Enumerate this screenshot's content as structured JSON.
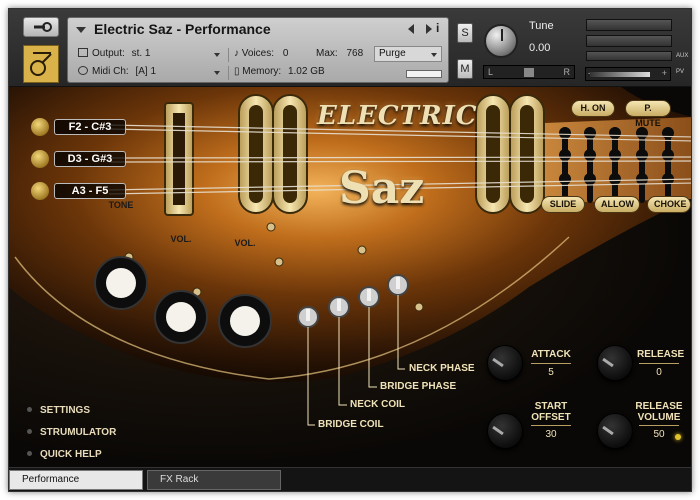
{
  "header": {
    "title": "Electric Saz - Performance",
    "output_label": "Output:",
    "output_value": "st. 1",
    "voices_label": "Voices:",
    "voices_value": "0",
    "max_label": "Max:",
    "max_value": "768",
    "purge_label": "Purge",
    "midi_label": "Midi Ch:",
    "midi_value": "[A]  1",
    "memory_label": "Memory:",
    "memory_value": "1.02 GB",
    "solo": "S",
    "mute": "M",
    "tune_label": "Tune",
    "tune_value": "0.00",
    "pan_left": "L",
    "pan_right": "R",
    "vol_minus": "-",
    "vol_plus": "+",
    "aux": "AUX",
    "pv": "PV"
  },
  "strings": [
    {
      "label": "F2 - C#3"
    },
    {
      "label": "D3 - G#3"
    },
    {
      "label": "A3 - F5"
    }
  ],
  "logo": {
    "line1": "ELECTRIC",
    "line2": "Saz"
  },
  "articulations": {
    "top": [
      "H. ON",
      "P. MUTE"
    ],
    "bottom": [
      "SLIDE",
      "ALLOW",
      "CHOKE"
    ]
  },
  "guitar_knobs": [
    "TONE",
    "VOL.",
    "VOL."
  ],
  "switches": [
    "NECK PHASE",
    "BRIDGE PHASE",
    "NECK COIL",
    "BRIDGE COIL"
  ],
  "envelope": {
    "attack_label": "ATTACK",
    "attack_value": "5",
    "release_label": "RELEASE",
    "release_value": "0",
    "start_offset_label": "START OFFSET",
    "start_offset_value": "30",
    "release_volume_label": "RELEASE VOLUME",
    "release_volume_value": "50"
  },
  "menu": [
    "SETTINGS",
    "STRUMULATOR",
    "QUICK HELP"
  ],
  "tabs": {
    "active": "Performance",
    "other": "FX Rack"
  },
  "colors": {
    "gold": "#d9b24a",
    "cream": "#f0e2b8",
    "wood_dark": "#2a1d10"
  }
}
